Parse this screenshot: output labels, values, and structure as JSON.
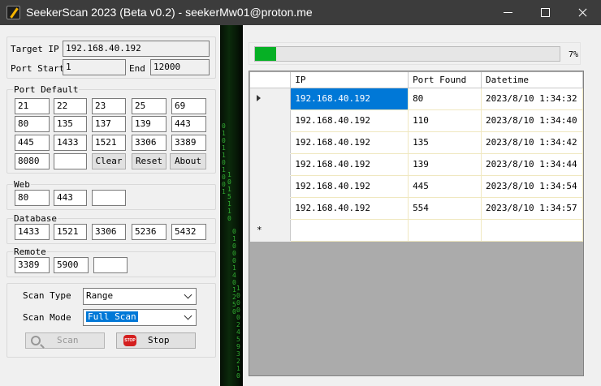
{
  "window": {
    "title": "SeekerScan 2023 (Beta v0.2) - seekerMw01@proton.me"
  },
  "target": {
    "ip_label": "Target IP",
    "ip_value": "192.168.40.192",
    "port_start_label": "Port Start",
    "port_start_value": "1",
    "end_label": "End",
    "end_value": "12000"
  },
  "port_default": {
    "title": "Port Default",
    "rows": [
      [
        "21",
        "22",
        "23",
        "25",
        "69"
      ],
      [
        "80",
        "135",
        "137",
        "139",
        "443"
      ],
      [
        "445",
        "1433",
        "1521",
        "3306",
        "3389"
      ]
    ],
    "last_row": [
      "8080",
      ""
    ],
    "clear_label": "Clear",
    "reset_label": "Reset",
    "about_label": "About"
  },
  "web": {
    "title": "Web",
    "ports": [
      "80",
      "443",
      ""
    ]
  },
  "database": {
    "title": "Database",
    "ports": [
      "1433",
      "1521",
      "3306",
      "5236",
      "5432"
    ]
  },
  "remote": {
    "title": "Remote",
    "ports": [
      "3389",
      "5900",
      ""
    ]
  },
  "scan": {
    "type_label": "Scan Type",
    "type_value": "Range",
    "mode_label": "Scan Mode",
    "mode_value": "Full Scan",
    "scan_button": "Scan",
    "stop_button": "Stop",
    "stop_icon_text": "STOP"
  },
  "progress": {
    "percent": 7,
    "label": "7%",
    "fill_color": "#06b025"
  },
  "results": {
    "columns": [
      "IP",
      "Port Found",
      "Datetime"
    ],
    "rows": [
      {
        "ip": "192.168.40.192",
        "port": "80",
        "datetime": "2023/8/10 1:34:32"
      },
      {
        "ip": "192.168.40.192",
        "port": "110",
        "datetime": "2023/8/10 1:34:40"
      },
      {
        "ip": "192.168.40.192",
        "port": "135",
        "datetime": "2023/8/10 1:34:42"
      },
      {
        "ip": "192.168.40.192",
        "port": "139",
        "datetime": "2023/8/10 1:34:44"
      },
      {
        "ip": "192.168.40.192",
        "port": "445",
        "datetime": "2023/8/10 1:34:54"
      },
      {
        "ip": "192.168.40.192",
        "port": "554",
        "datetime": "2023/8/10 1:34:57"
      }
    ],
    "new_row_marker": "*"
  },
  "matrix_columns": [
    "0101101001",
    "1 0 1 5 1 1 0",
    "010001 4 012 5 0",
    "1 0 0 0 0 2 4 5 9 3 2 1 0"
  ],
  "colors": {
    "accent": "#0078d7",
    "titlebar": "#3c3c3c",
    "matrix_green": "#3fdc3f"
  }
}
